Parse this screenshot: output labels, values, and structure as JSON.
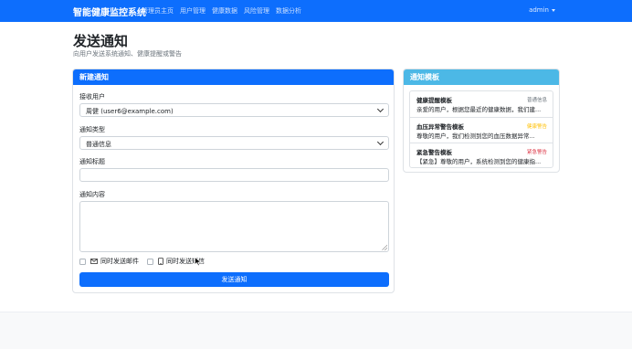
{
  "navbar": {
    "brand": "智能健康监控系统",
    "links": [
      "管理员主页",
      "用户管理",
      "健康数据",
      "风险管理",
      "数据分析"
    ],
    "user": "admin",
    "color": "#0d6efd"
  },
  "page": {
    "title": "发送通知",
    "subtitle": "向用户发送系统通知、健康提醒或警告"
  },
  "form": {
    "header": "新建通知",
    "recipient_label": "接收用户",
    "recipient_value": "周健 (user6@example.com)",
    "type_label": "通知类型",
    "type_value": "普通信息",
    "title_label": "通知标题",
    "title_value": "",
    "content_label": "通知内容",
    "content_value": "",
    "email_option": "同时发送邮件",
    "sms_option": "同时发送短信",
    "submit_label": "发送通知"
  },
  "templates": {
    "header": "通知模板",
    "header_color": "#4cb8e6",
    "items": [
      {
        "name": "健康提醒模板",
        "badge": "普通信息",
        "badge_color": "#6c757d",
        "preview": "亲爱的用户，根据您最近的健康数据，我们建..."
      },
      {
        "name": "血压异常警告模板",
        "badge": "健康警告",
        "badge_color": "#ffc107",
        "preview": "尊敬的用户，我们检测到您的血压数据异常..."
      },
      {
        "name": "紧急警告模板",
        "badge": "紧急警告",
        "badge_color": "#dc3545",
        "preview": "【紧急】尊敬的用户，系统检测到您的健康指..."
      }
    ]
  },
  "icons": {
    "email": "envelope-icon",
    "sms": "mobile-phone-icon",
    "caret": "caret-down-icon"
  }
}
